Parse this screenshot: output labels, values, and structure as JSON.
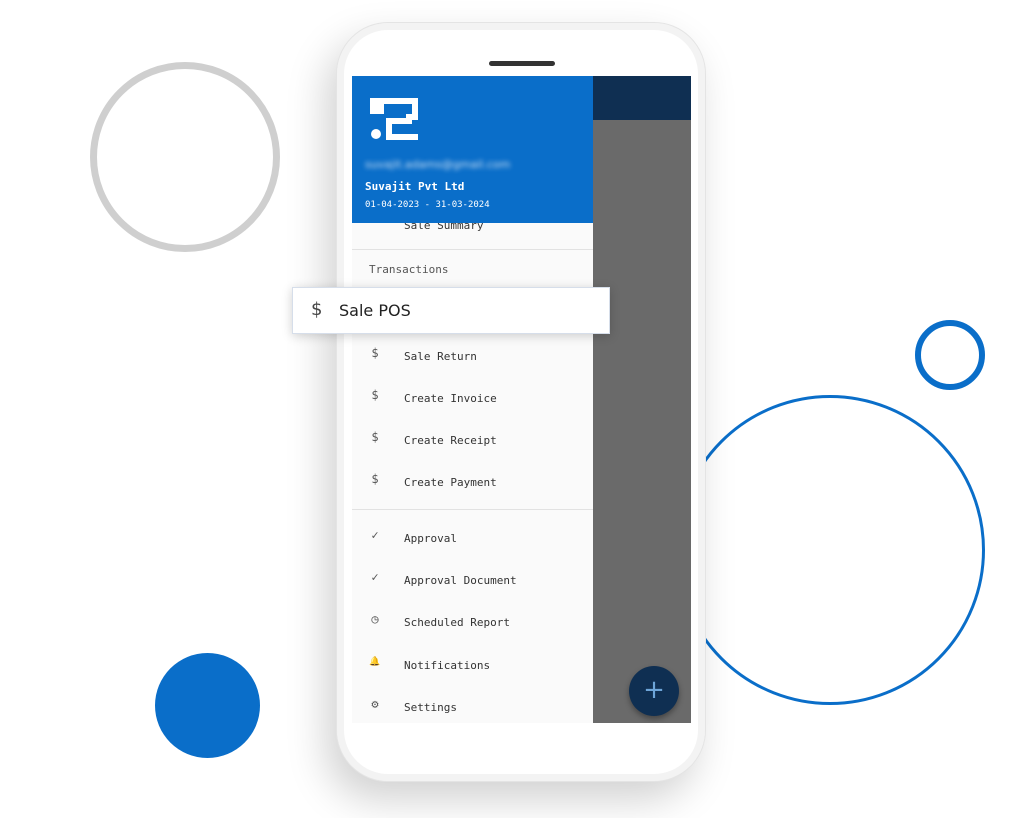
{
  "drawer": {
    "header": {
      "email": "suvajit.adams@gmail.com",
      "company": "Suvajit Pvt Ltd",
      "period": "01-04-2023 - 31-03-2024"
    },
    "partial_item": "Sale Summary",
    "section_title": "Transactions",
    "transactions": [
      {
        "icon": "$",
        "label": "Sale Return"
      },
      {
        "icon": "$",
        "label": "Create Invoice"
      },
      {
        "icon": "$",
        "label": "Create Receipt"
      },
      {
        "icon": "$",
        "label": "Create Payment"
      }
    ],
    "others": [
      {
        "icon": "✓",
        "label": "Approval"
      },
      {
        "icon": "✓",
        "label": "Approval Document"
      },
      {
        "icon": "◷",
        "label": "Scheduled Report"
      },
      {
        "icon": "🔔",
        "label": "Notifications"
      },
      {
        "icon": "⚙",
        "label": "Settings"
      }
    ]
  },
  "highlight": {
    "icon": "$",
    "label": "Sale POS"
  },
  "fab": {
    "icon": "+"
  },
  "colors": {
    "brand": "#0a6ec9",
    "app_bar": "#0f2f52",
    "scrim": "#6a6a6a"
  }
}
